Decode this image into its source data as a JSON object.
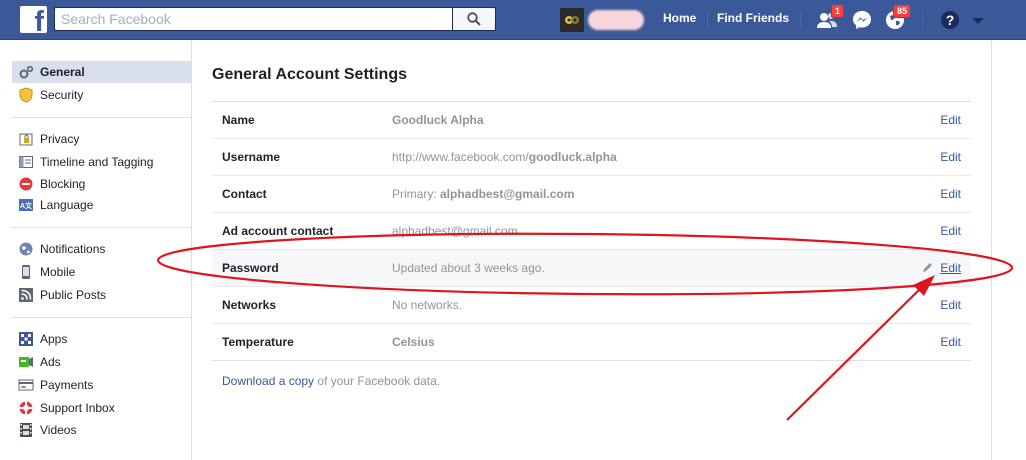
{
  "topbar": {
    "search_placeholder": "Search Facebook",
    "home_label": "Home",
    "find_friends_label": "Find Friends",
    "friend_requests_count": "1",
    "notifications_count": "85"
  },
  "sidebar": {
    "groups": [
      [
        {
          "label": "General",
          "icon": "gear-icon",
          "active": true
        },
        {
          "label": "Security",
          "icon": "shield-icon"
        }
      ],
      [
        {
          "label": "Privacy",
          "icon": "lock-icon"
        },
        {
          "label": "Timeline and Tagging",
          "icon": "timeline-icon"
        },
        {
          "label": "Blocking",
          "icon": "block-icon"
        },
        {
          "label": "Language",
          "icon": "language-icon"
        }
      ],
      [
        {
          "label": "Notifications",
          "icon": "globe-icon"
        },
        {
          "label": "Mobile",
          "icon": "mobile-icon"
        },
        {
          "label": "Public Posts",
          "icon": "rss-icon"
        }
      ],
      [
        {
          "label": "Apps",
          "icon": "apps-icon"
        },
        {
          "label": "Ads",
          "icon": "ads-icon"
        },
        {
          "label": "Payments",
          "icon": "card-icon"
        },
        {
          "label": "Support Inbox",
          "icon": "lifebuoy-icon"
        },
        {
          "label": "Videos",
          "icon": "film-icon"
        }
      ]
    ]
  },
  "main": {
    "title": "General Account Settings",
    "edit_label": "Edit",
    "rows": [
      {
        "label": "Name",
        "value": "Goodluck Alpha"
      },
      {
        "label": "Username",
        "value_prefix": "http://www.facebook.com/",
        "value_bold": "goodluck.alpha"
      },
      {
        "label": "Contact",
        "value_prefix": "Primary: ",
        "value_bold": "alphadbest@gmail.com"
      },
      {
        "label": "Ad account contact",
        "value": "alphadbest@gmail.com"
      },
      {
        "label": "Password",
        "value": "Updated about 3 weeks ago."
      },
      {
        "label": "Networks",
        "value": "No networks."
      },
      {
        "label": "Temperature",
        "value": "Celsius"
      }
    ],
    "download_link": "Download a copy",
    "download_rest": " of your Facebook data."
  },
  "colors": {
    "brand": "#3b5998",
    "link": "#365899",
    "annotation": "#e0141e",
    "badge": "#fa3e3e"
  }
}
